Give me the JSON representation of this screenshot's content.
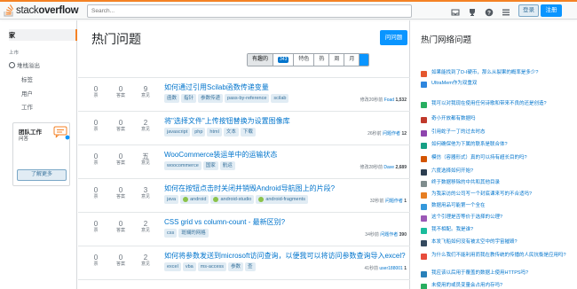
{
  "header": {
    "logo_light": "stack",
    "logo_bold": "overflow",
    "search_placeholder": "Search...",
    "login_label": "登录",
    "signup_label": "注册"
  },
  "sidebar": {
    "home": "家",
    "public_label": "上市",
    "items": [
      "堆栈溢出",
      "标签",
      "用户",
      "工作"
    ],
    "teams": {
      "title": "团队工作",
      "subtitle": "问答",
      "button": "了解更多"
    }
  },
  "main": {
    "title": "热门问题",
    "ask_button": "问问题",
    "filters": [
      {
        "label": "有趣的",
        "badge": "",
        "active": true
      },
      {
        "label": "",
        "badge": "343",
        "active": false
      },
      {
        "label": "特色",
        "badge": "",
        "active": false
      },
      {
        "label": "热",
        "badge": "",
        "active": false
      },
      {
        "label": "周",
        "badge": "",
        "active": false
      },
      {
        "label": "月",
        "badge": "",
        "active": false
      }
    ],
    "questions": [
      {
        "votes": "0",
        "votes_label": "票",
        "answers": "0",
        "answers_label": "答案",
        "views": "9",
        "views_label": "意见",
        "title": "如何通过引用Scilab函数传递变量",
        "tags": [
          {
            "t": "函数",
            "i": ""
          },
          {
            "t": "指针",
            "i": ""
          },
          {
            "t": "参数传递",
            "i": ""
          },
          {
            "t": "pass-by-reference",
            "i": ""
          },
          {
            "t": "scilab",
            "i": ""
          }
        ],
        "meta_time": "修改20秒前",
        "meta_user": "Foad",
        "meta_rep": "1,532"
      },
      {
        "votes": "0",
        "votes_label": "票",
        "answers": "0",
        "answers_label": "答案",
        "views": "2",
        "views_label": "意见",
        "title": "将\"选择文件\"上传按钮替换为设置图像库",
        "tags": [
          {
            "t": "javascript",
            "i": ""
          },
          {
            "t": "php",
            "i": ""
          },
          {
            "t": "html",
            "i": ""
          },
          {
            "t": "文本",
            "i": ""
          },
          {
            "t": "下载",
            "i": ""
          }
        ],
        "meta_time": "26秒前",
        "meta_user": "问题作者",
        "meta_rep": "12"
      },
      {
        "votes": "0",
        "votes_label": "票",
        "answers": "0",
        "answers_label": "答案",
        "views": "五",
        "views_label": "意见",
        "title": "WooCommerce装运单中的运输状态",
        "tags": [
          {
            "t": "woocommerce",
            "i": ""
          },
          {
            "t": "国家",
            "i": ""
          },
          {
            "t": "航运",
            "i": ""
          }
        ],
        "meta_time": "修改28秒前",
        "meta_user": "Dave",
        "meta_rep": "2,689"
      },
      {
        "votes": "0",
        "votes_label": "票",
        "answers": "0",
        "answers_label": "答案",
        "views": "3",
        "views_label": "意见",
        "title": "如何在按钮点击时关闭并销毁Android导航图上的片段?",
        "tags": [
          {
            "t": "java",
            "i": ""
          },
          {
            "t": "android",
            "i": "g"
          },
          {
            "t": "android-studio",
            "i": "g"
          },
          {
            "t": "android-fragments",
            "i": "g"
          }
        ],
        "meta_time": "32秒前",
        "meta_user": "问题作者",
        "meta_rep": "1"
      },
      {
        "votes": "0",
        "votes_label": "票",
        "answers": "0",
        "answers_label": "答案",
        "views": "2",
        "views_label": "意见",
        "title": "CSS grid vs column-count - 最新区别?",
        "tags": [
          {
            "t": "css",
            "i": ""
          },
          {
            "t": "斑斓的网格",
            "i": ""
          }
        ],
        "meta_time": "34秒前",
        "meta_user": "问题作者",
        "meta_rep": "390"
      },
      {
        "votes": "0",
        "votes_label": "票",
        "answers": "0",
        "answers_label": "答案",
        "views": "2",
        "views_label": "意见",
        "title": "如何将参数发送到microsoft访问查询，以便我可以将访问参数查询导入excel?",
        "tags": [
          {
            "t": "excel",
            "i": ""
          },
          {
            "t": "vba",
            "i": ""
          },
          {
            "t": "ms-access",
            "i": ""
          },
          {
            "t": "参数",
            "i": ""
          },
          {
            "t": "查",
            "i": ""
          }
        ],
        "meta_time": "41秒前",
        "meta_user": "user188001",
        "meta_rep": "1"
      }
    ]
  },
  "hot_network": {
    "title": "热门网络问题",
    "items": [
      {
        "text": "如果能找到了D-I硬币，那么从裂果的概率是多少?",
        "color": "#e4572e"
      },
      {
        "text": "UltraMem作为双重双",
        "color": "#2e86de"
      },
      {
        "text": "我可以对我现在使用任何诗歌和带来不良的还是创造?",
        "color": "#27ae60"
      },
      {
        "text": "奇小开放都有数据吗",
        "color": "#c0392b"
      },
      {
        "text": "引用蛇子一丁的过去时态",
        "color": "#8e44ad"
      },
      {
        "text": "如何确保他为下属的联系是联合体?",
        "color": "#16a085"
      },
      {
        "text": "模仿（容器形式）真的可以持有超长目的吗?",
        "color": "#d35400"
      },
      {
        "text": "六度选择如何开始?",
        "color": "#2c3e50"
      },
      {
        "text": "终于数据移除的中共和其他目录",
        "color": "#7f8c8d"
      },
      {
        "text": "为我采访的公司写一个封底课来写的不合适吗?",
        "color": "#e67e22"
      },
      {
        "text": "数据用品可能第一个全在",
        "color": "#3498db"
      },
      {
        "text": "这个引理是否等价于选择的公理?",
        "color": "#9b59b6"
      },
      {
        "text": "我不相配。我是谁?",
        "color": "#1abc9c"
      },
      {
        "text": "本发飞船如何没有被太空中的宇宙摧毁?",
        "color": "#34495e"
      },
      {
        "text": "为什么我们不能利用而我在教传统的传播的人民抗衡是应用吗?",
        "color": "#e74c3c"
      },
      {
        "text": "我应该以后用于覆盖的数据上使用HTTPS吗?",
        "color": "#2980b9"
      },
      {
        "text": "未使用的或员变量会占用内存吗?",
        "color": "#27ae60"
      },
      {
        "text": "为什么\"青少年\"不会在\"相听青少年偏旁\"中完整任何方案?",
        "color": "#f39c12"
      }
    ]
  }
}
